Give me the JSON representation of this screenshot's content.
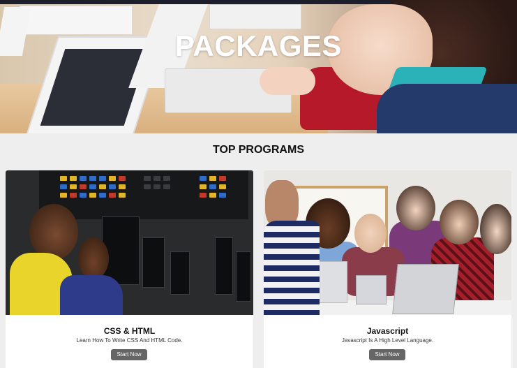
{
  "hero": {
    "title": "PACKAGES"
  },
  "section": {
    "title": "TOP PROGRAMS"
  },
  "cards": [
    {
      "title": "CSS & HTML",
      "description": "Learn How To Write CSS And HTML Code.",
      "button_label": "Start Now"
    },
    {
      "title": "Javascript",
      "description": "Javascript Is A High Level Language.",
      "button_label": "Start Now"
    }
  ],
  "colors": {
    "page_background": "#eeeeee",
    "card_background": "#ffffff",
    "button_background": "#666666",
    "hero_title": "#ffffff",
    "heading_text": "#111111"
  }
}
